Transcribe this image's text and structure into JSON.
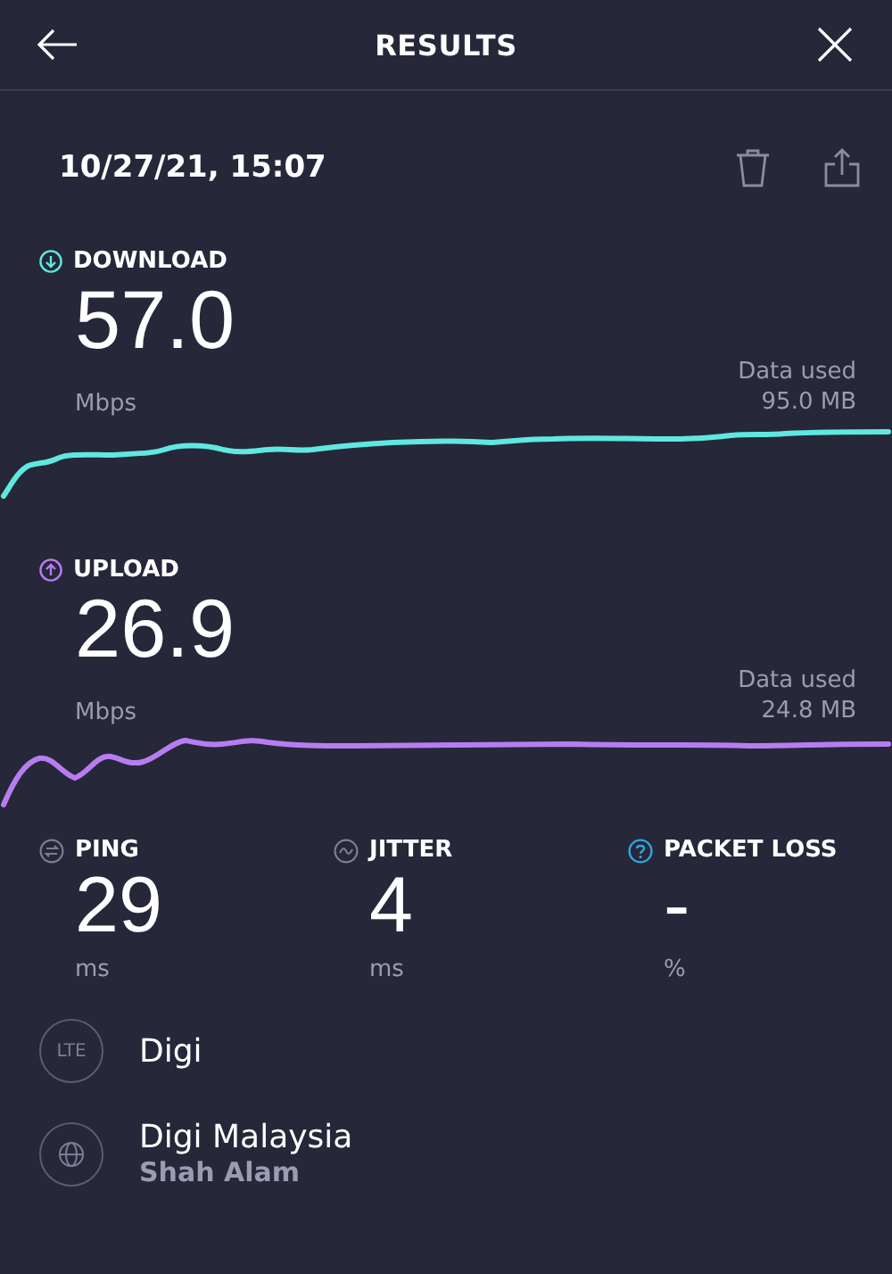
{
  "header": {
    "title": "RESULTS"
  },
  "result": {
    "timestamp": "10/27/21, 15:07"
  },
  "tests": [
    {
      "kind": "download",
      "label": "DOWNLOAD",
      "value": "57.0",
      "unit": "Mbps",
      "data_label": "Data used",
      "data_value": "95.0 MB",
      "color": "#5ee8e0"
    },
    {
      "kind": "upload",
      "label": "UPLOAD",
      "value": "26.9",
      "unit": "Mbps",
      "data_label": "Data used",
      "data_value": "24.8 MB",
      "color": "#b77df0"
    }
  ],
  "metrics": [
    {
      "kind": "ping",
      "label": "PING",
      "value": "29",
      "unit": "ms"
    },
    {
      "kind": "jitter",
      "label": "JITTER",
      "value": "4",
      "unit": "ms"
    },
    {
      "kind": "packet_loss",
      "label": "PACKET LOSS",
      "value": "-",
      "unit": "%"
    }
  ],
  "connections": [
    {
      "kind": "network",
      "badge": "LTE",
      "name": "Digi"
    },
    {
      "kind": "server",
      "name": "Digi Malaysia",
      "location": "Shah Alam"
    }
  ]
}
